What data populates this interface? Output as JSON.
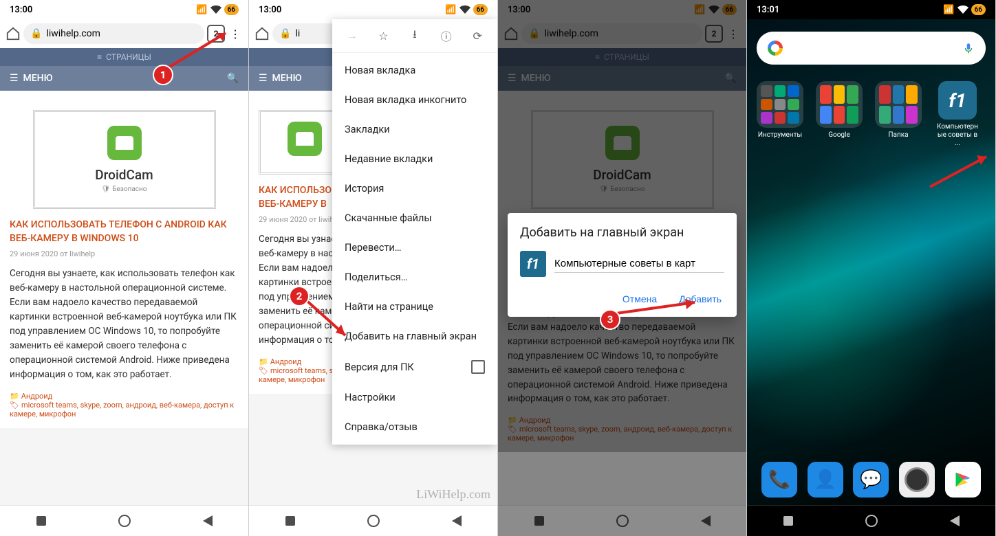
{
  "status": {
    "time": "13:00",
    "time4": "13:01",
    "battery": "66"
  },
  "toolbar": {
    "url": "liwihelp.com",
    "tabs": "2"
  },
  "site": {
    "pages": "СТРАНИЦЫ",
    "menu": "МЕНЮ"
  },
  "card": {
    "title": "DroidCam",
    "badge": "Безопасно"
  },
  "article": {
    "title": "КАК ИСПОЛЬЗОВАТЬ ТЕЛЕФОН С ANDROID КАК ВЕБ-КАМЕРУ В WINDOWS 10",
    "meta": "29 июня 2020 от liwihelp",
    "text": "Сегодня вы узнаете, как использовать телефон как веб-камеру в настольной операционной системе. Если вам надоело качество передаваемой картинки встроенной веб-камерой ноутбука или ПК под управлением ОС Windows 10, то попробуйте заменить её камерой своего телефона с операционной системой Android. Ниже приведена информация о том, как это работает.",
    "cat": "Андроид",
    "tags": "microsoft teams, skype, zoom, андроид, веб-камера, доступ к камере, микрофон"
  },
  "menu": {
    "items": [
      "Новая вкладка",
      "Новая вкладка инкогнито",
      "Закладки",
      "Недавние вкладки",
      "История",
      "Скачанные файлы",
      "Перевести…",
      "Поделиться…",
      "Найти на странице",
      "Добавить на главный экран",
      "Версия для ПК",
      "Настройки",
      "Справка/отзыв"
    ]
  },
  "dialog": {
    "title": "Добавить на главный экран",
    "input": "Компьютерные советы в карт",
    "cancel": "Отмена",
    "add": "Добавить"
  },
  "home": {
    "folders": [
      "Инструменты",
      "Google",
      "Папка",
      "Компьютерн\nые советы в ..."
    ]
  },
  "badges": {
    "b1": "1",
    "b2": "2",
    "b3": "3"
  },
  "watermark": "LiWiHelp.com"
}
